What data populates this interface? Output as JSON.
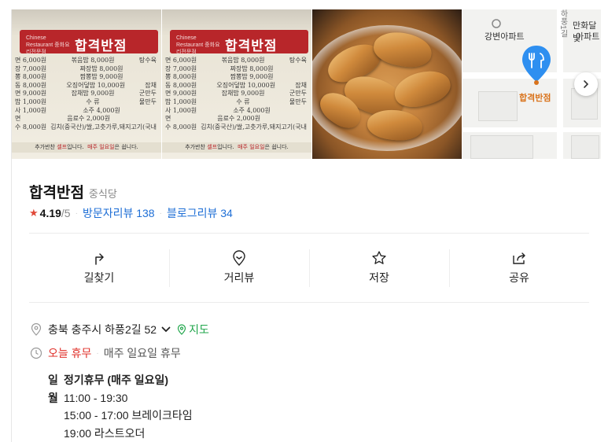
{
  "photos": {
    "menu_board": {
      "banner_title": "합격반점",
      "banner_sub": "Chinese Restaurant 중화요리전문점",
      "rows": [
        {
          "left": "면 6,000원",
          "mid": "볶음밥 8,000원",
          "right": "탕수육"
        },
        {
          "left": "장 7,000원",
          "mid": "짜장밥 8,000원",
          "right": ""
        },
        {
          "left": "뽕 8,000원",
          "mid": "짬뽕밥 9,000원",
          "right": ""
        },
        {
          "left": "동 8,000원",
          "mid": "오징어덮밥 10,000원",
          "right": "잡채"
        },
        {
          "left": "면 9,000원",
          "mid": "잡채밥 9,000원",
          "right": "군만두"
        },
        {
          "left": "밥 1,000원",
          "mid": "수 류",
          "right": "물만두"
        },
        {
          "left": "사 1,000원",
          "mid": "소주 4,000원",
          "right": ""
        },
        {
          "left": "면",
          "mid": "음료수 2,000원",
          "right": ""
        },
        {
          "left": "수 8,000원",
          "mid": "김치(중국산)/쌀,고춧가루,돼지고기(국내",
          "right": ""
        }
      ],
      "footer_left": "추가반찬",
      "footer_self": "셀프",
      "footer_mid": "입니다.",
      "footer_closed": "매주 일요일",
      "footer_end": "은 쉽니다."
    },
    "map": {
      "label_apartment": "강변아파트",
      "label_apartment2": "만화달빛",
      "label_apartment3": "아파트",
      "label_road": "하풍1길",
      "label_place": "합격반점"
    }
  },
  "place": {
    "name": "합격반점",
    "category": "중식당",
    "rating": "4.19",
    "rating_max": "/5",
    "visitor_reviews": "방문자리뷰 138",
    "blog_reviews": "블로그리뷰 34"
  },
  "actions": [
    {
      "label": "길찾기",
      "icon": "directions-icon"
    },
    {
      "label": "거리뷰",
      "icon": "street-view-icon"
    },
    {
      "label": "저장",
      "icon": "star-icon"
    },
    {
      "label": "공유",
      "icon": "share-icon"
    }
  ],
  "info": {
    "address": "충북 충주시 하풍2길 52",
    "map_link": "지도",
    "today_status": "오늘 휴무",
    "closed_rule": "매주 일요일 휴무"
  },
  "hours": {
    "sun_day": "일",
    "sun_text": "정기휴무 (매주 일요일)",
    "mon_day": "월",
    "mon_hours": "11:00 - 19:30",
    "break_time": "15:00 - 17:00 브레이크타임",
    "last_order": "19:00 라스트오더"
  },
  "colors": {
    "accent_blue": "#1f6fd6",
    "rating_red": "#e04838",
    "green": "#20a64b",
    "closed_red": "#e0302a",
    "pin_blue": "#2e8ff0"
  }
}
